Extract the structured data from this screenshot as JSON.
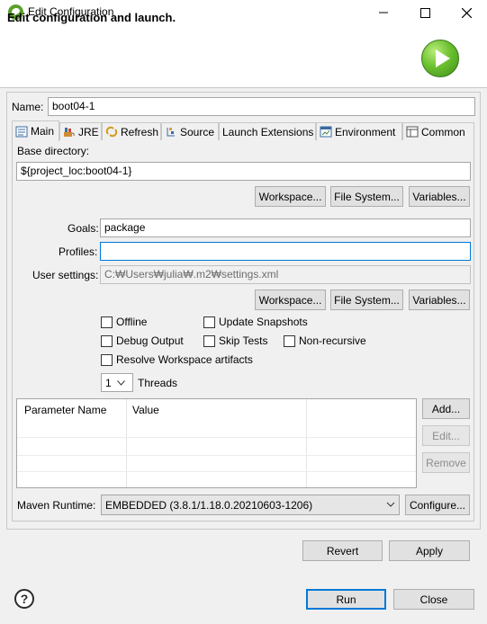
{
  "window": {
    "title": "Edit Configuration"
  },
  "header": {
    "title": "Edit configuration and launch."
  },
  "name": {
    "label": "Name:",
    "value": "boot04-1"
  },
  "tabs": [
    {
      "label": "Main",
      "icon": "main-tab-icon"
    },
    {
      "label": "JRE",
      "icon": "jre-icon"
    },
    {
      "label": "Refresh",
      "icon": "refresh-icon"
    },
    {
      "label": "Source",
      "icon": "source-icon"
    },
    {
      "label": "Launch Extensions",
      "icon": ""
    },
    {
      "label": "Environment",
      "icon": "environment-icon"
    },
    {
      "label": "Common",
      "icon": "common-icon"
    }
  ],
  "main": {
    "base_dir_label": "Base directory:",
    "base_dir_value": "${project_loc:boot04-1}",
    "workspace_label": "Workspace...",
    "file_system_label": "File System...",
    "variables_label": "Variables...",
    "goals_label": "Goals:",
    "goals_value": "package",
    "profiles_label": "Profiles:",
    "profiles_value": "",
    "user_settings_label": "User settings:",
    "user_settings_value": "C:₩Users₩julia₩.m2₩settings.xml",
    "checkboxes": {
      "offline": "Offline",
      "update_snapshots": "Update Snapshots",
      "debug_output": "Debug Output",
      "skip_tests": "Skip Tests",
      "non_recursive": "Non-recursive",
      "resolve_workspace": "Resolve Workspace artifacts"
    },
    "threads_value": "1",
    "threads_label": "Threads",
    "table": {
      "columns": [
        "Parameter Name",
        "Value"
      ]
    },
    "add_label": "Add...",
    "edit_label": "Edit...",
    "remove_label": "Remove",
    "runtime_label": "Maven Runtime:",
    "runtime_value": "EMBEDDED (3.8.1/1.18.0.20210603-1206)",
    "configure_label": "Configure..."
  },
  "footer": {
    "revert_label": "Revert",
    "apply_label": "Apply",
    "run_label": "Run",
    "close_label": "Close",
    "help_glyph": "?"
  }
}
